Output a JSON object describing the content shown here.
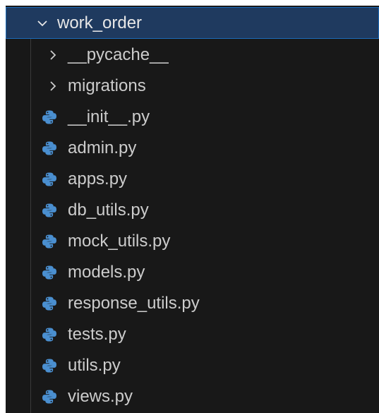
{
  "explorer": {
    "root_folder": {
      "label": "work_order",
      "expanded": true,
      "icon": "chevron-down-icon"
    },
    "subfolders": [
      {
        "label": "__pycache__",
        "expanded": false,
        "icon": "chevron-right-icon"
      },
      {
        "label": "migrations",
        "expanded": false,
        "icon": "chevron-right-icon"
      }
    ],
    "files": [
      {
        "label": "__init__.py",
        "icon": "python-file-icon"
      },
      {
        "label": "admin.py",
        "icon": "python-file-icon"
      },
      {
        "label": "apps.py",
        "icon": "python-file-icon"
      },
      {
        "label": "db_utils.py",
        "icon": "python-file-icon"
      },
      {
        "label": "mock_utils.py",
        "icon": "python-file-icon"
      },
      {
        "label": "models.py",
        "icon": "python-file-icon"
      },
      {
        "label": "response_utils.py",
        "icon": "python-file-icon"
      },
      {
        "label": "tests.py",
        "icon": "python-file-icon"
      },
      {
        "label": "utils.py",
        "icon": "python-file-icon"
      },
      {
        "label": "views.py",
        "icon": "python-file-icon"
      }
    ]
  },
  "colors": {
    "background": "#181818",
    "selected_background": "#1f3a5f",
    "selected_border": "#1c6bb8",
    "text": "#cccccc",
    "python_icon": "#4a8fd0"
  }
}
